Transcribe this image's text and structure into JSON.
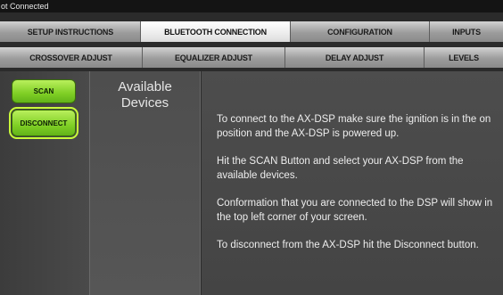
{
  "status": {
    "text": "ot Connected"
  },
  "tabs_row1": [
    {
      "label": "SETUP INSTRUCTIONS",
      "active": false
    },
    {
      "label": "BLUETOOTH CONNECTION",
      "active": true
    },
    {
      "label": "CONFIGURATION",
      "active": false
    },
    {
      "label": "INPUTS",
      "active": false
    }
  ],
  "tabs_row2": [
    {
      "label": "CROSSOVER ADJUST"
    },
    {
      "label": "EQUALIZER ADJUST"
    },
    {
      "label": "DELAY ADJUST"
    },
    {
      "label": "LEVELS"
    }
  ],
  "buttons": {
    "scan": "SCAN",
    "disconnect": "DISCONNECT"
  },
  "devices": {
    "title_line1": "Available",
    "title_line2": "Devices"
  },
  "instructions": [
    "To connect to the AX-DSP make sure the ignition is in the on position and the AX-DSP is powered up.",
    "Hit the SCAN Button and select your AX-DSP from the available devices.",
    "Conformation that you are connected to the DSP will show in the top left corner of your screen.",
    "To disconnect from the AX-DSP hit the Disconnect button."
  ],
  "colors": {
    "accent_green": "#7fcf25",
    "active_tab": "#ececec",
    "background": "#2b2b2b"
  }
}
